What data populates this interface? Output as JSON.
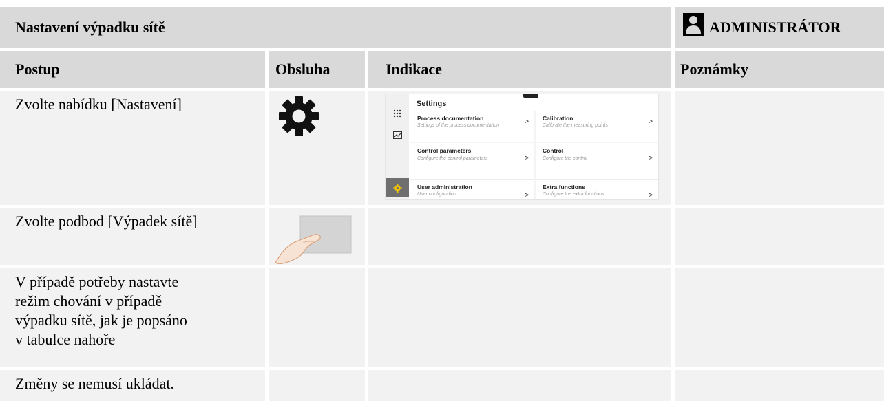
{
  "header": {
    "title": "Nastavení výpadku sítě",
    "role": "ADMINISTRÁTOR",
    "role_icon": "user-icon"
  },
  "columns": {
    "postup": "Postup",
    "obsluha": "Obsluha",
    "indikace": "Indikace",
    "poznamky": "Poznámky"
  },
  "rows": [
    {
      "postup": "Zvolte nabídku [Nastavení]",
      "obsluha_icon": "gear-icon"
    },
    {
      "postup": "Zvolte podbod [Výpadek sítě]",
      "obsluha_icon": "tap-hand-icon"
    },
    {
      "postup_lines": [
        "V případě potřeby nastavte",
        "režim chování v případě",
        "výpadku sítě, jak je popsáno",
        "v tabulce nahoře"
      ]
    },
    {
      "postup": "Změny se nemusí ukládat."
    }
  ],
  "screenshot": {
    "title": "Settings",
    "accent": "#f5c400",
    "tiles": [
      {
        "title": "Process documentation",
        "subtitle": "Settings of the process documentation"
      },
      {
        "title": "Calibration",
        "subtitle": "Calibrate the measuring points"
      },
      {
        "title": "Control parameters",
        "subtitle": "Configure the control parameters"
      },
      {
        "title": "Control",
        "subtitle": "Configure the control"
      },
      {
        "title": "User administration",
        "subtitle": "User configuration"
      },
      {
        "title": "Extra functions",
        "subtitle": "Configure the extra functions"
      }
    ],
    "chevron": ">"
  },
  "colors": {
    "header_bg": "#d9d9d9",
    "cell_bg": "#f2f2f2"
  }
}
